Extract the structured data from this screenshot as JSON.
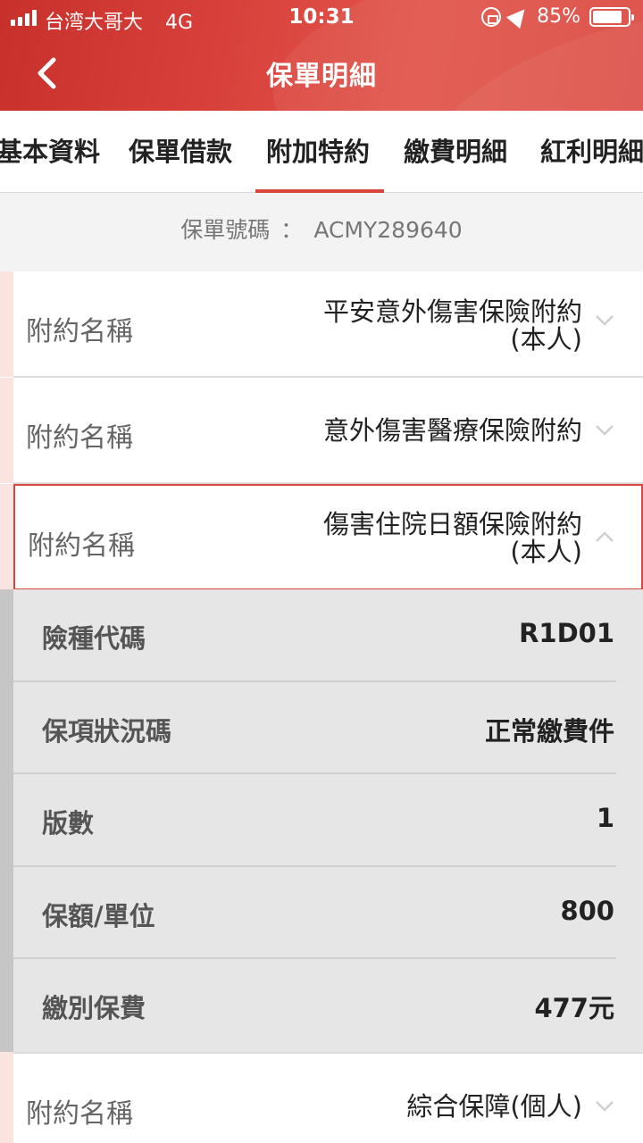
{
  "status_bar": {
    "carrier": "台湾大哥大",
    "network": "4G",
    "time": "10:31",
    "battery": "85%"
  },
  "header": {
    "title": "保單明細",
    "back_icon": "chevron-left-icon"
  },
  "tabs": [
    {
      "label": "基本資料",
      "active": false
    },
    {
      "label": "保單借款",
      "active": false
    },
    {
      "label": "附加特約",
      "active": true
    },
    {
      "label": "繳費明細",
      "active": false
    },
    {
      "label": "紅利明細",
      "active": false
    }
  ],
  "policy": {
    "label": "保單號碼",
    "separator": "：",
    "number": "ACMY289640"
  },
  "riders": [
    {
      "label": "附約名稱",
      "name_line1": "平安意外傷害保險附約",
      "name_line2": "(本人)",
      "expanded": false
    },
    {
      "label": "附約名稱",
      "name_line1": "意外傷害醫療保險附約",
      "name_line2": "",
      "expanded": false
    },
    {
      "label": "附約名稱",
      "name_line1": "傷害住院日額保險附約",
      "name_line2": "(本人)",
      "expanded": true
    },
    {
      "label": "附約名稱",
      "name_line1": "綜合保障(個人)",
      "name_line2": "",
      "expanded": false
    }
  ],
  "details": [
    {
      "label": "險種代碼",
      "value": "R1D01"
    },
    {
      "label": "保項狀況碼",
      "value": "正常繳費件"
    },
    {
      "label": "版數",
      "value": "1"
    },
    {
      "label": "保額/單位",
      "value": "800"
    },
    {
      "label": "繳別保費",
      "value": "477元"
    }
  ],
  "colors": {
    "brand_red": "#d9463d",
    "detail_bg": "#e6e6e6",
    "band_bg": "#f3f3f3"
  }
}
